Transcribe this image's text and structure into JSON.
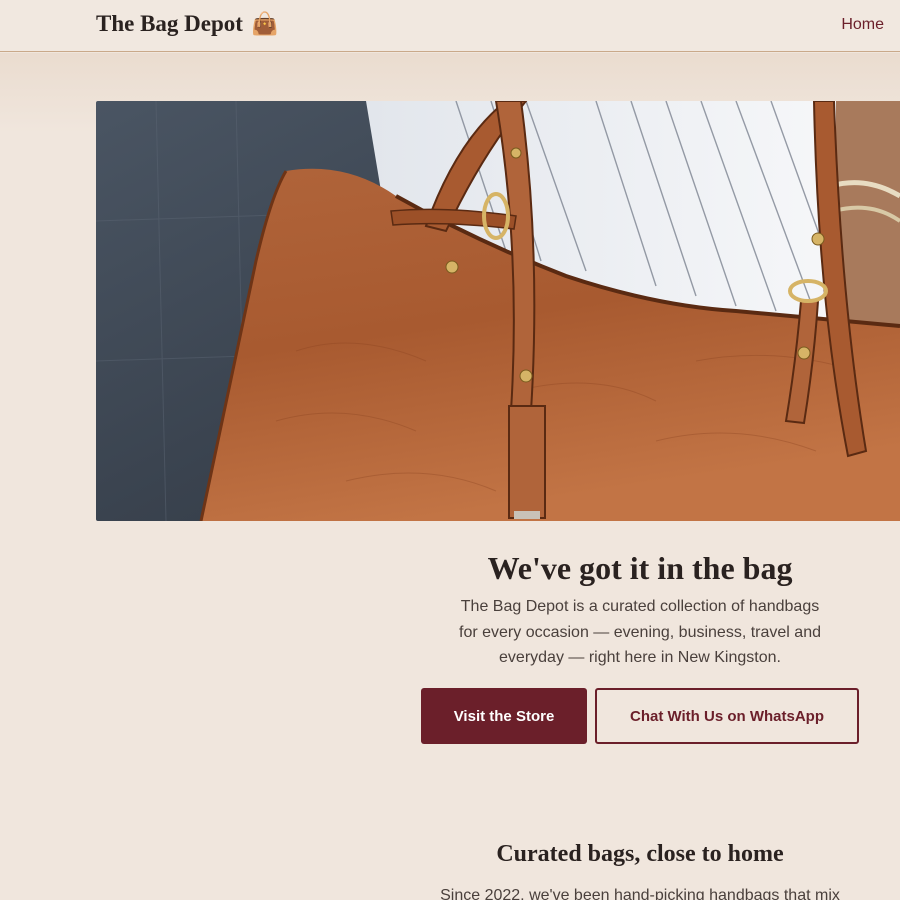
{
  "header": {
    "brand": "The Bag Depot",
    "brand_icon": "handbag-icon",
    "brand_emoji": "👜",
    "nav": {
      "home": "Home"
    }
  },
  "hero": {
    "image_alt": "Brown leather tote bag",
    "title": "We've got it in the bag",
    "description": "The Bag Depot is a curated collection of handbags for every occasion — evening, business, travel and everyday — right here in New Kingston.",
    "primary_button": "Visit the Store",
    "secondary_button": "Chat With Us on WhatsApp"
  },
  "about": {
    "title": "Curated bags, close to home",
    "body": "Since 2022, we've been hand-picking handbags that mix"
  },
  "colors": {
    "accent": "#6b1f2a",
    "background": "#f0e6dd",
    "leather": "#a85a30"
  }
}
